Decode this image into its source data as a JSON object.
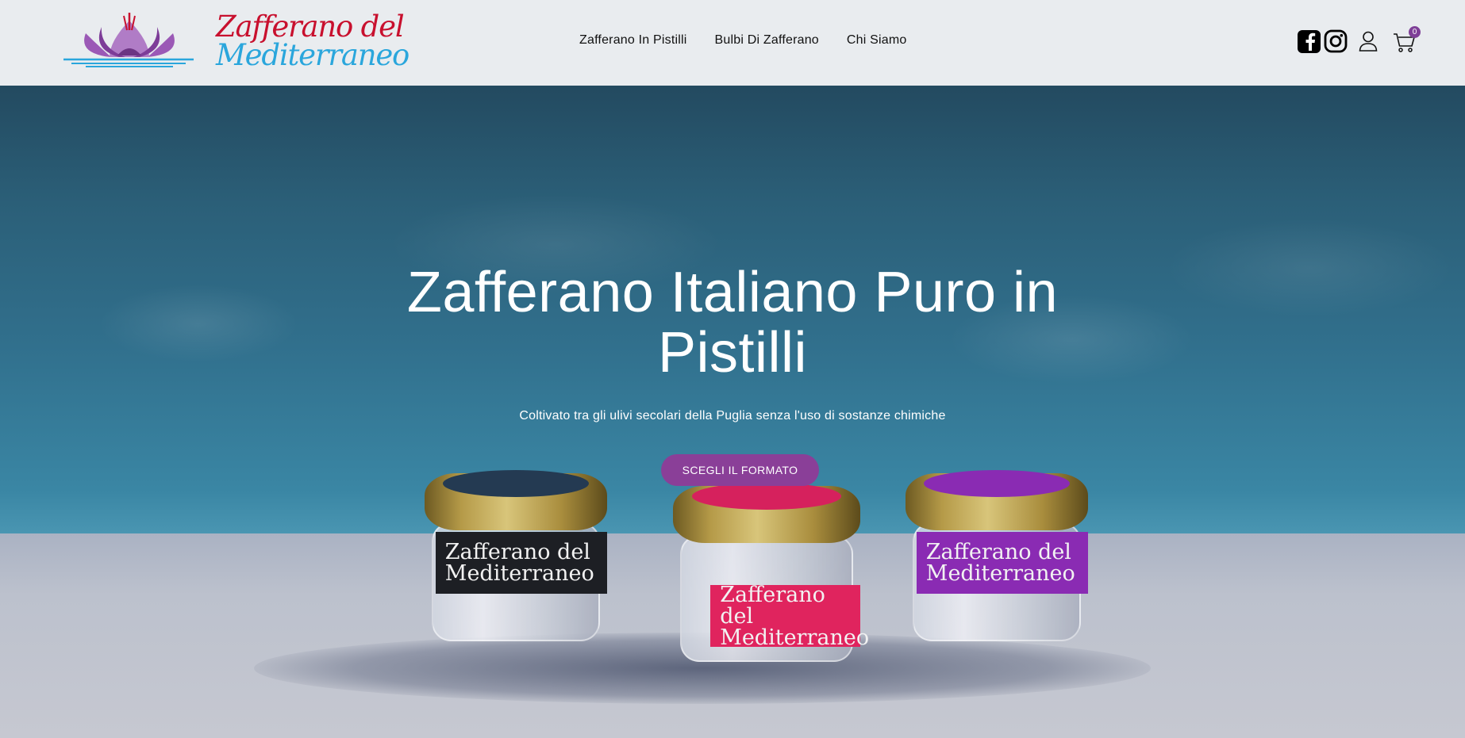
{
  "brand": {
    "line1": "Zafferano del",
    "line2": "Mediterraneo"
  },
  "nav": {
    "items": [
      "Zafferano In Pistilli",
      "Bulbi Di Zafferano",
      "Chi Siamo"
    ]
  },
  "header_icons": {
    "facebook": "facebook-icon",
    "instagram": "instagram-icon",
    "account": "user-icon",
    "cart": "cart-icon",
    "cart_count": "0"
  },
  "hero": {
    "title_line1": "Zafferano Italiano Puro in",
    "title_line2": "Pistilli",
    "subtitle": "Coltivato tra gli ulivi secolari della Puglia senza l'uso di sostanze chimiche",
    "cta_label": "SCEGLI IL FORMATO"
  },
  "jars": [
    {
      "label_line1": "Zafferano del",
      "label_line2": "Mediterraneo",
      "color": "#1d1f24"
    },
    {
      "label_line1": "Zafferano del",
      "label_line2": "Mediterraneo",
      "color": "#e0245e"
    },
    {
      "label_line1": "Zafferano del",
      "label_line2": "Mediterraneo",
      "color": "#8a2bb3"
    }
  ],
  "colors": {
    "accent": "#8a3f98",
    "brand_red": "#c8102e",
    "brand_blue": "#2aa6dc",
    "logo_purple": "#8e4aa6"
  }
}
